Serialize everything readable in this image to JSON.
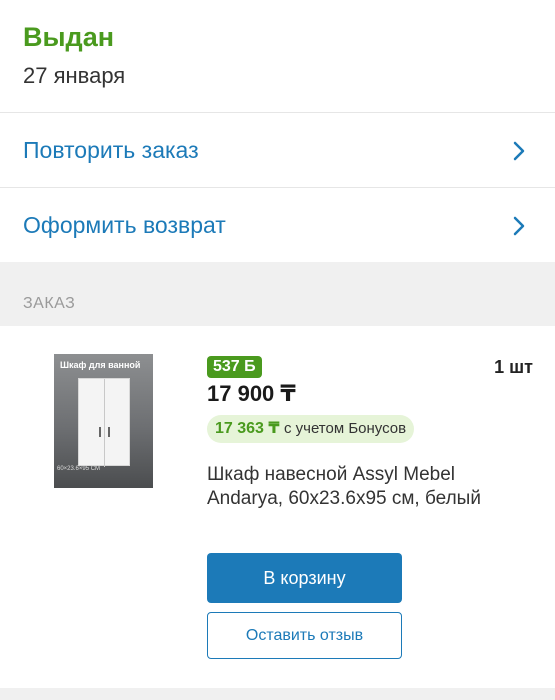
{
  "order_status": {
    "title": "Выдан",
    "date": "27 января",
    "title_color": "#4a9a1e"
  },
  "actions": [
    {
      "label": "Повторить заказ",
      "icon": "chevron-right-icon"
    },
    {
      "label": "Оформить возврат",
      "icon": "chevron-right-icon"
    }
  ],
  "section": {
    "label": "ЗАКАЗ"
  },
  "product": {
    "image_caption": "Шкаф для ванной",
    "image_dimensions_label": "60×23.6×95 CM",
    "bonus_badge": "537 Б",
    "price": "17 900 ₸",
    "quantity": "1 шт",
    "bonus_price": "17 363 ₸",
    "bonus_note": "с учетом Бонусов",
    "name": "Шкаф навесной Assyl Mebel Andarya, 60x23.6x95 см, белый"
  },
  "buttons": {
    "add_to_cart": "В корзину",
    "leave_review": "Оставить отзыв"
  },
  "colors": {
    "accent_blue": "#1c7ab8",
    "bonus_green": "#4a9a1e",
    "bonus_bg": "#e6f4d8"
  }
}
